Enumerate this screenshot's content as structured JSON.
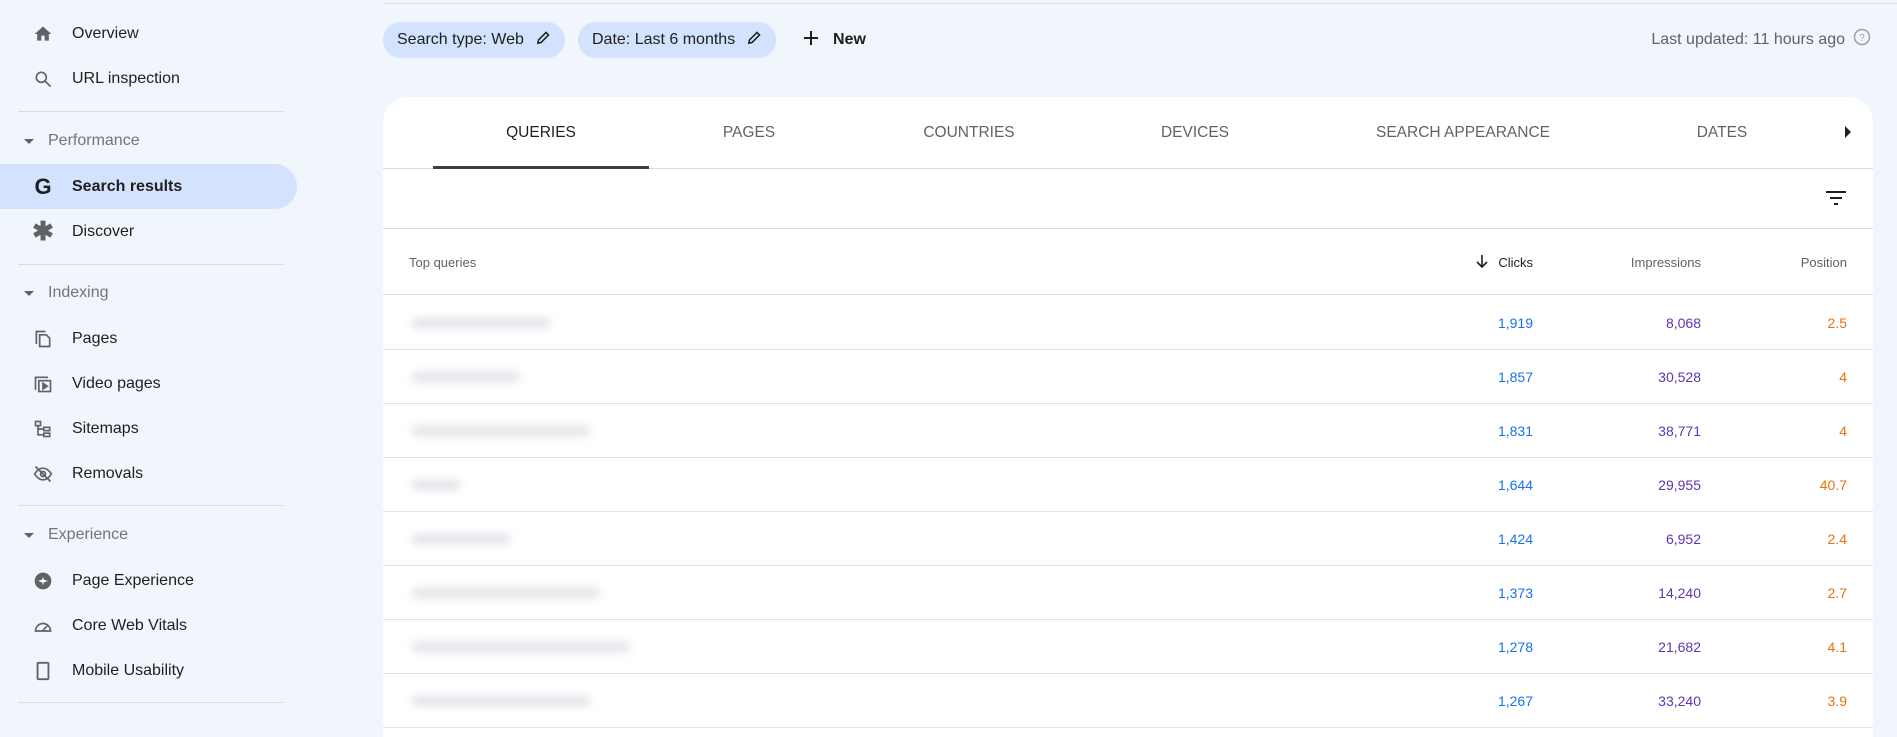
{
  "sidebar": {
    "top_items": [
      {
        "label": "Overview",
        "icon": "home-icon"
      },
      {
        "label": "URL inspection",
        "icon": "search-icon"
      }
    ],
    "sections": [
      {
        "title": "Performance",
        "items": [
          {
            "label": "Search results",
            "icon": "google-g-icon",
            "active": true
          },
          {
            "label": "Discover",
            "icon": "asterisk-icon"
          }
        ]
      },
      {
        "title": "Indexing",
        "items": [
          {
            "label": "Pages",
            "icon": "pages-icon"
          },
          {
            "label": "Video pages",
            "icon": "video-pages-icon"
          },
          {
            "label": "Sitemaps",
            "icon": "sitemap-icon"
          },
          {
            "label": "Removals",
            "icon": "eye-off-icon"
          }
        ]
      },
      {
        "title": "Experience",
        "items": [
          {
            "label": "Page Experience",
            "icon": "page-experience-icon"
          },
          {
            "label": "Core Web Vitals",
            "icon": "gauge-icon"
          },
          {
            "label": "Mobile Usability",
            "icon": "phone-icon"
          }
        ]
      }
    ]
  },
  "filters": {
    "search_type": "Search type: Web",
    "date": "Date: Last 6 months",
    "new_label": "New"
  },
  "last_updated": "Last updated: 11 hours ago",
  "tabs": [
    "QUERIES",
    "PAGES",
    "COUNTRIES",
    "DEVICES",
    "SEARCH APPEARANCE",
    "DATES"
  ],
  "active_tab": "QUERIES",
  "table": {
    "headers": {
      "query": "Top queries",
      "clicks": "Clicks",
      "impressions": "Impressions",
      "position": "Position"
    },
    "sort": "clicks-descending",
    "rows": [
      {
        "clicks": "1,919",
        "impressions": "8,068",
        "position": "2.5"
      },
      {
        "clicks": "1,857",
        "impressions": "30,528",
        "position": "4"
      },
      {
        "clicks": "1,831",
        "impressions": "38,771",
        "position": "4"
      },
      {
        "clicks": "1,644",
        "impressions": "29,955",
        "position": "40.7"
      },
      {
        "clicks": "1,424",
        "impressions": "6,952",
        "position": "2.4"
      },
      {
        "clicks": "1,373",
        "impressions": "14,240",
        "position": "2.7"
      },
      {
        "clicks": "1,278",
        "impressions": "21,682",
        "position": "4.1"
      },
      {
        "clicks": "1,267",
        "impressions": "33,240",
        "position": "3.9"
      }
    ]
  },
  "colors": {
    "clicks": "#1a73e8",
    "impressions": "#5e35b1",
    "position": "#e8710a",
    "active_nav": "#d3e3fd"
  }
}
